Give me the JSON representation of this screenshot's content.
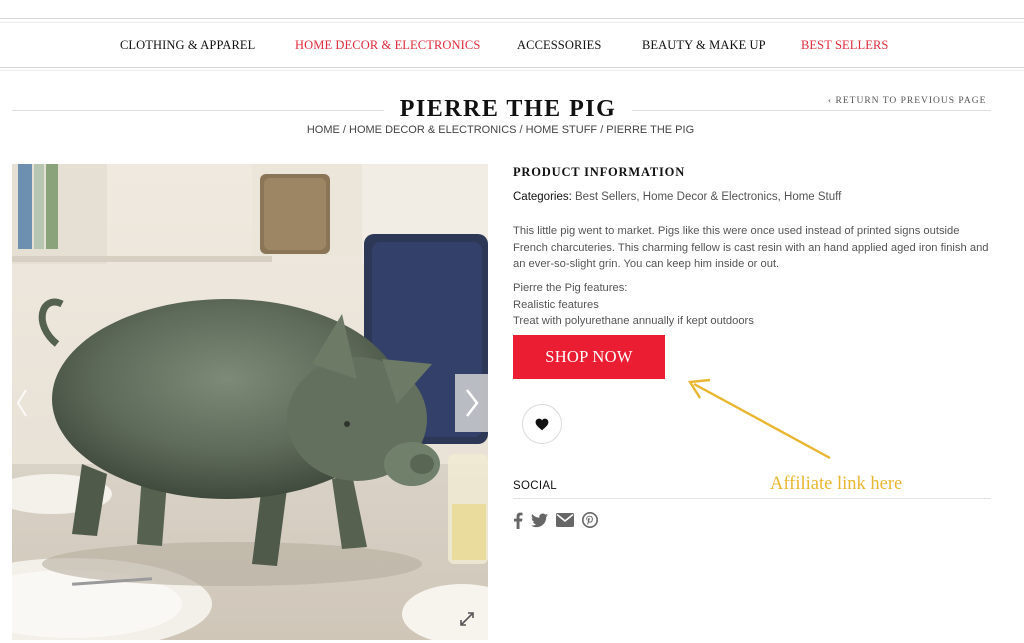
{
  "nav": {
    "items": [
      {
        "label": "CLOTHING & APPAREL",
        "color": "#111111"
      },
      {
        "label": "HOME DECOR & ELECTRONICS",
        "color": "#e02b3c"
      },
      {
        "label": "ACCESSORIES",
        "color": "#111111"
      },
      {
        "label": "BEAUTY & MAKE UP",
        "color": "#111111"
      },
      {
        "label": "BEST SELLERS",
        "color": "#e02b3c"
      }
    ]
  },
  "page": {
    "title": "PIERRE THE PIG",
    "return_label": "‹ RETURN TO PREVIOUS PAGE",
    "breadcrumb": "HOME / HOME DECOR & ELECTRONICS / HOME STUFF / PIERRE THE PIG"
  },
  "product": {
    "info_heading": "PRODUCT INFORMATION",
    "categories_label": "Categories:",
    "categories": [
      "Best Sellers",
      "Home Decor & Electronics",
      "Home Stuff"
    ],
    "description": "This little pig went to market. Pigs like this were once used instead of printed signs outside French charcuteries. This charming fellow is cast resin with an hand applied aged iron finish and an ever-so-slight grin. You can keep him inside or out.",
    "features_title": "Pierre the Pig features:",
    "features": [
      "Realistic features",
      "Treat with polyurethane annually if kept outdoors"
    ],
    "shop_button": "SHOP NOW",
    "social_label": "SOCIAL",
    "social_icons": [
      "facebook-icon",
      "twitter-icon",
      "email-icon",
      "pinterest-icon"
    ]
  },
  "annotation": {
    "text": "Affiliate link here",
    "color": "#e8b630"
  },
  "colors": {
    "accent": "#ea1d33",
    "link_red": "#e02b3c"
  }
}
